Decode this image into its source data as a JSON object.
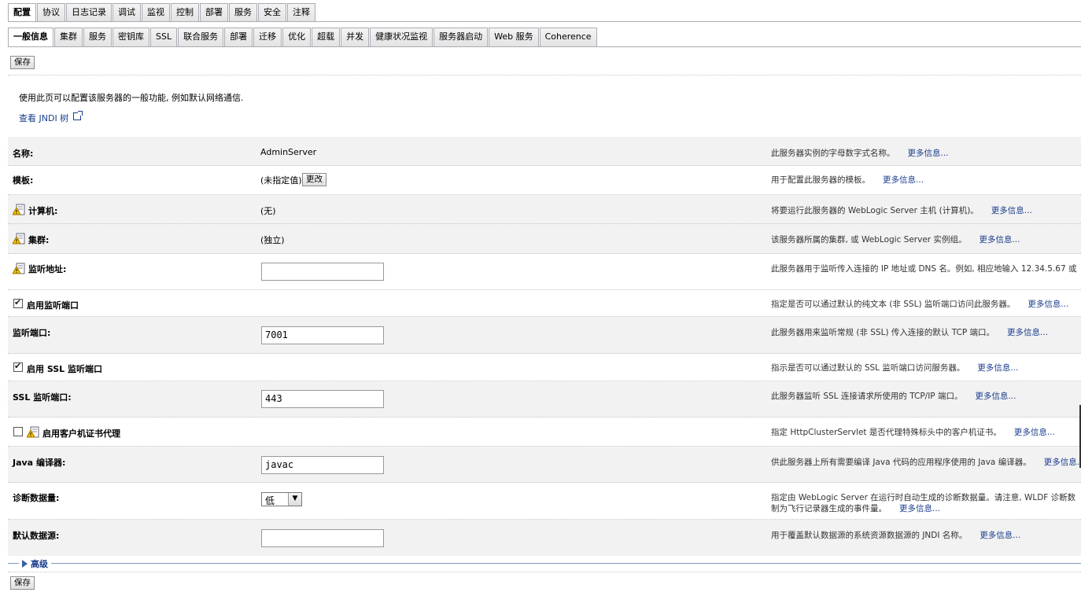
{
  "tabs_top": [
    "配置",
    "协议",
    "日志记录",
    "调试",
    "监视",
    "控制",
    "部署",
    "服务",
    "安全",
    "注释"
  ],
  "tabs_sub": [
    "一般信息",
    "集群",
    "服务",
    "密钥库",
    "SSL",
    "联合服务",
    "部署",
    "迁移",
    "优化",
    "超载",
    "并发",
    "健康状况监视",
    "服务器启动",
    "Web 服务",
    "Coherence"
  ],
  "save_label": "保存",
  "intro_text": "使用此页可以配置该服务器的一般功能, 例如默认网络通信.",
  "jndi_link": "查看 JNDI 树",
  "more_info": "更多信息...",
  "fields": {
    "name": {
      "label": "名称:",
      "value": "AdminServer",
      "help": "此服务器实例的字母数字式名称。"
    },
    "template": {
      "label": "模板:",
      "value": "(未指定值)",
      "button": "更改",
      "help": "用于配置此服务器的模板。"
    },
    "machine": {
      "label": "计算机:",
      "value": "(无)",
      "help": "将要运行此服务器的 WebLogic Server 主机 (计算机)。"
    },
    "cluster": {
      "label": "集群:",
      "value": "(独立)",
      "help": "该服务器所属的集群, 或 WebLogic Server 实例组。"
    },
    "listen_address": {
      "label": "监听地址:",
      "value": "",
      "help": "此服务器用于监听传入连接的 IP 地址或 DNS 名。例如, 相应地输入 12.34.5.67 或"
    },
    "listen_port_enabled": {
      "label": "启用监听端口",
      "checked": true,
      "help": "指定是否可以通过默认的纯文本 (非 SSL) 监听端口访问此服务器。"
    },
    "listen_port": {
      "label": "监听端口:",
      "value": "7001",
      "help": "此服务器用来监听常规 (非 SSL) 传入连接的默认 TCP 端口。"
    },
    "ssl_port_enabled": {
      "label": "启用 SSL 监听端口",
      "checked": true,
      "help": "指示是否可以通过默认的 SSL 监听端口访问服务器。"
    },
    "ssl_port": {
      "label": "SSL 监听端口:",
      "value": "443",
      "help": "此服务器监听 SSL 连接请求所使用的 TCP/IP 端口。"
    },
    "client_cert_proxy": {
      "label": "启用客户机证书代理",
      "checked": false,
      "help": "指定 HttpClusterServlet 是否代理特殊标头中的客户机证书。"
    },
    "java_compiler": {
      "label": "Java 编译器:",
      "value": "javac",
      "help": "供此服务器上所有需要编译 Java 代码的应用程序使用的 Java 编译器。"
    },
    "diag_volume": {
      "label": "诊断数据量:",
      "value": "低",
      "help1": "指定由 WebLogic Server 在运行时自动生成的诊断数据量。请注意, WLDF 诊断数",
      "help2": "制为飞行记录器生成的事件量。"
    },
    "default_datasource": {
      "label": "默认数据源:",
      "value": "",
      "help": "用于覆盖默认数据源的系统资源数据源的 JNDI 名称。"
    }
  },
  "advanced_label": "高级",
  "icons": {
    "warning": "change-center-warning-icon",
    "external": "external-link-icon"
  }
}
